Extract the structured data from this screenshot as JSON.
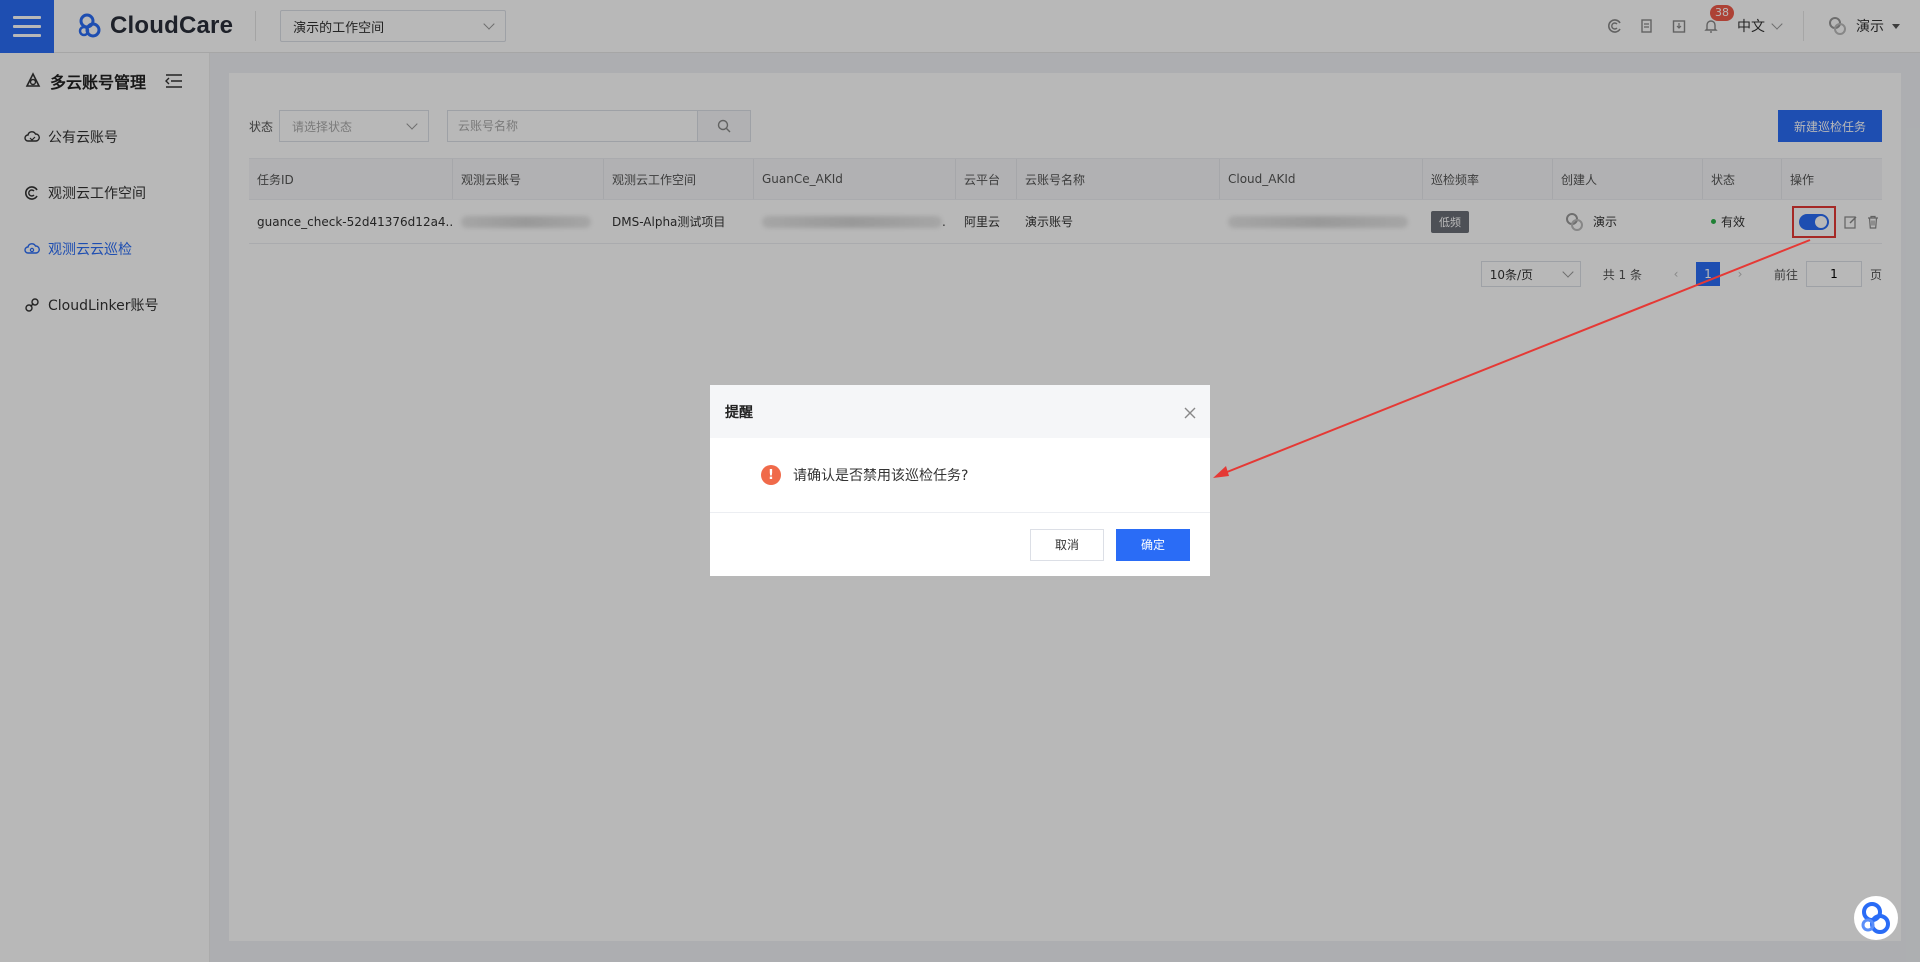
{
  "header": {
    "brand": "CloudCare",
    "workspace": "演示的工作空间",
    "notification_count": "38",
    "language": "中文",
    "user": "演示"
  },
  "sidebar": {
    "title": "多云账号管理",
    "items": [
      {
        "label": "公有云账号",
        "icon": "cloud-icon"
      },
      {
        "label": "观测云工作空间",
        "icon": "guance-icon"
      },
      {
        "label": "观测云云巡检",
        "icon": "inspection-icon",
        "active": true
      },
      {
        "label": "CloudLinker账号",
        "icon": "link-icon"
      }
    ]
  },
  "filters": {
    "status_label": "状态",
    "status_placeholder": "请选择状态",
    "search_placeholder": "云账号名称",
    "new_button": "新建巡检任务"
  },
  "table": {
    "headers": [
      "任务ID",
      "观测云账号",
      "观测云工作空间",
      "GuanCe_AKId",
      "云平台",
      "云账号名称",
      "Cloud_AKId",
      "巡检频率",
      "创建人",
      "状态",
      "操作"
    ],
    "rows": [
      {
        "task_id": "guance_check-52d41376d12a4...",
        "workspace": "DMS-Alpha测试项目",
        "ak_suffix": ".",
        "platform": "阿里云",
        "account_name": "演示账号",
        "frequency": "低频",
        "creator": "演示",
        "status": "有效"
      }
    ]
  },
  "pager": {
    "page_size": "10条/页",
    "total": "共 1 条",
    "current": "1",
    "goto_label": "前往",
    "goto_value": "1",
    "page_unit": "页"
  },
  "dialog": {
    "title": "提醒",
    "message": "请确认是否禁用该巡检任务?",
    "cancel": "取消",
    "confirm": "确定"
  },
  "colors": {
    "primary": "#2a6cf6",
    "warning": "#f06a4a",
    "annotation": "#e53935"
  }
}
